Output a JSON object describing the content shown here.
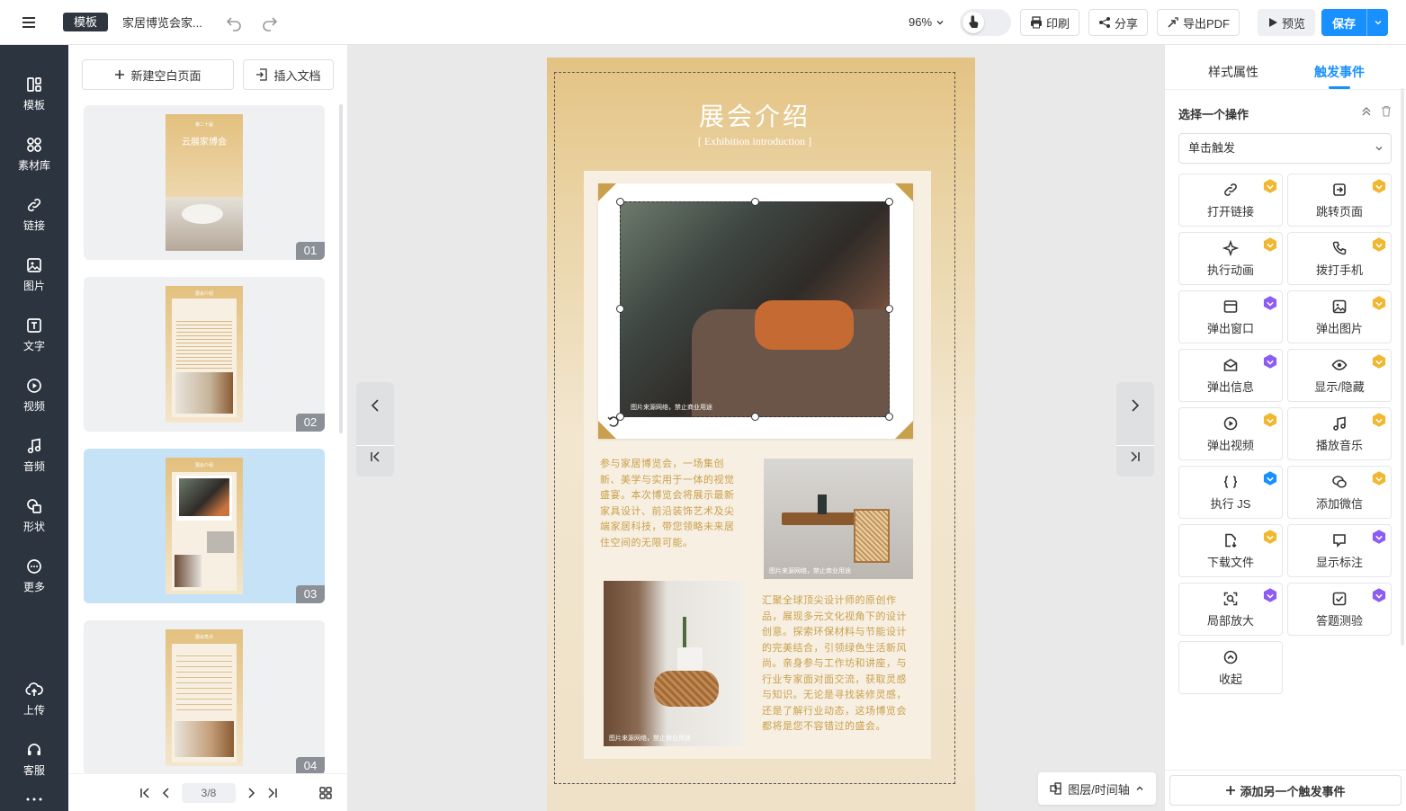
{
  "header": {
    "template_badge": "模板",
    "doc_title": "家居博览会家...",
    "zoom": "96%",
    "print_label": "印刷",
    "share_label": "分享",
    "export_label": "导出PDF",
    "preview_label": "预览",
    "save_label": "保存"
  },
  "sidebar": {
    "items": [
      {
        "label": "模板",
        "icon": "template-icon"
      },
      {
        "label": "素材库",
        "icon": "material-icon"
      },
      {
        "label": "链接",
        "icon": "link-icon"
      },
      {
        "label": "图片",
        "icon": "image-icon"
      },
      {
        "label": "文字",
        "icon": "text-icon"
      },
      {
        "label": "视频",
        "icon": "video-icon"
      },
      {
        "label": "音频",
        "icon": "audio-icon"
      },
      {
        "label": "形状",
        "icon": "shape-icon"
      },
      {
        "label": "更多",
        "icon": "more-icon"
      },
      {
        "label": "上传",
        "icon": "upload-icon"
      },
      {
        "label": "客服",
        "icon": "support-icon"
      }
    ]
  },
  "pages_panel": {
    "new_page_label": "新建空白页面",
    "insert_doc_label": "插入文档",
    "pages": [
      {
        "num": "01",
        "title": "云展家博会",
        "top_text": "第二十届"
      },
      {
        "num": "02",
        "title": "展会介绍"
      },
      {
        "num": "03",
        "title": "展会介绍",
        "active": true
      },
      {
        "num": "04",
        "title": "展会亮点"
      }
    ],
    "pager": "3/8"
  },
  "poster": {
    "title": "展会介绍",
    "subtitle": "Exhibition introduction",
    "caption": "图片来源网络，禁止商业用途",
    "paragraph1": "参与家居博览会，一场集创新、美学与实用于一体的视觉盛宴。本次博览会将展示最新家具设计、前沿装饰艺术及尖端家居科技，带您领略未来居住空间的无限可能。",
    "paragraph2": "汇聚全球顶尖设计师的原创作品，展现多元文化视角下的设计创意。探索环保材料与节能设计的完美结合，引领绿色生活新风尚。亲身参与工作坊和讲座，与行业专家面对面交流，获取灵感与知识。无论是寻找装修灵感，还是了解行业动态，这场博览会都将是您不容错过的盛会。"
  },
  "canvas": {
    "layer_label": "图层/时间轴"
  },
  "right_panel": {
    "tabs": [
      "样式属性",
      "触发事件"
    ],
    "active_tab": "触发事件",
    "section_title": "选择一个操作",
    "trigger_select": "单击触发",
    "actions": [
      {
        "label": "打开链接",
        "icon": "link-icon",
        "badge": "gold"
      },
      {
        "label": "跳转页面",
        "icon": "jump-icon",
        "badge": "gold"
      },
      {
        "label": "执行动画",
        "icon": "sparkle-icon",
        "badge": "gold"
      },
      {
        "label": "拨打手机",
        "icon": "phone-icon",
        "badge": "gold"
      },
      {
        "label": "弹出窗口",
        "icon": "window-icon",
        "badge": "purple"
      },
      {
        "label": "弹出图片",
        "icon": "picture-icon",
        "badge": "gold"
      },
      {
        "label": "弹出信息",
        "icon": "mail-icon",
        "badge": "purple"
      },
      {
        "label": "显示/隐藏",
        "icon": "eye-icon",
        "badge": "gold"
      },
      {
        "label": "弹出视频",
        "icon": "play-icon",
        "badge": "gold"
      },
      {
        "label": "播放音乐",
        "icon": "music-icon",
        "badge": "gold"
      },
      {
        "label": "执行 JS",
        "icon": "code-icon",
        "badge": "blue"
      },
      {
        "label": "添加微信",
        "icon": "wechat-icon",
        "badge": "gold"
      },
      {
        "label": "下载文件",
        "icon": "download-icon",
        "badge": "gold"
      },
      {
        "label": "显示标注",
        "icon": "comment-icon",
        "badge": "purple"
      },
      {
        "label": "局部放大",
        "icon": "zoom-icon",
        "badge": "purple"
      },
      {
        "label": "答题测验",
        "icon": "quiz-icon",
        "badge": "purple"
      },
      {
        "label": "收起",
        "icon": "collapse-icon"
      }
    ],
    "add_event_label": "添加另一个触发事件"
  },
  "colors": {
    "accent": "#1890ff",
    "sidebar_bg": "#2c3440",
    "poster_gold": "#c9a04c",
    "badge_gold": "#f0b72f",
    "badge_purple": "#8b5cf6",
    "badge_blue": "#1890ff"
  }
}
